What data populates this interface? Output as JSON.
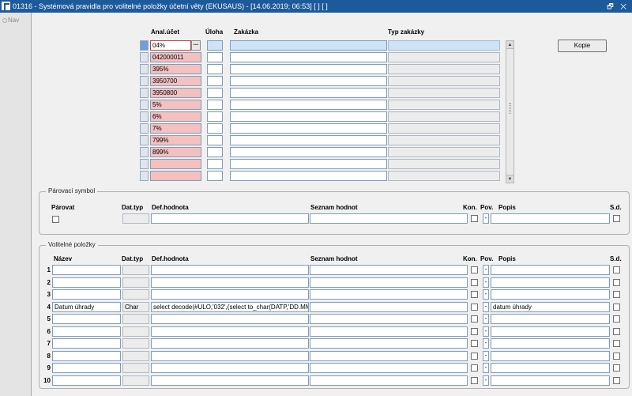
{
  "window": {
    "title": "01316 - Systémová pravidla pro volitelné položky účetní věty (EKUSAUS) - [14.06.2019; 06:53]  [ ]  [ ]",
    "controls": "🗗 ✕"
  },
  "nav": {
    "label": "Nav"
  },
  "top_table": {
    "headers": {
      "anal": "Anal.účet",
      "uloha": "Úloha",
      "zakazka": "Zakázka",
      "typ": "Typ zakázky"
    },
    "rows": [
      "04%",
      "042000011",
      "395%",
      "3950700",
      "3950800",
      "5%",
      "6%",
      "7%",
      "799%",
      "899%",
      "",
      ""
    ],
    "lov_button": "...",
    "copy_button": "Kopie"
  },
  "parovaci": {
    "legend": "Párovací symbol",
    "headers": {
      "parovat": "Párovat",
      "dattyp": "Dat.typ",
      "defhod": "Def.hodnota",
      "seznam": "Seznam hodnot",
      "kon": "Kon.",
      "pov": "Pov.",
      "popis": "Popis",
      "sd": "S.d."
    },
    "pov_value": "-"
  },
  "volitelne": {
    "legend": "Volitelné položky",
    "headers": {
      "nazev": "Název",
      "dattyp": "Dat.typ",
      "defhod": "Def.hodnota",
      "seznam": "Seznam hodnot",
      "kon": "Kon.",
      "pov": "Pov.",
      "popis": "Popis",
      "sd": "S.d."
    },
    "rows": [
      {
        "num": "1",
        "nazev": "",
        "dattyp": "",
        "defhod": "",
        "pov": "-",
        "popis": ""
      },
      {
        "num": "2",
        "nazev": "",
        "dattyp": "",
        "defhod": "",
        "pov": "-",
        "popis": ""
      },
      {
        "num": "3",
        "nazev": "",
        "dattyp": "",
        "defhod": "",
        "pov": "-",
        "popis": ""
      },
      {
        "num": "4",
        "nazev": "Datum úhrady",
        "dattyp": "Char",
        "defhod": "select decode(#ULO,'032',(select to_char(DATP,'DD.MM",
        "pov": "-",
        "popis": "datum úhrady"
      },
      {
        "num": "5",
        "nazev": "",
        "dattyp": "",
        "defhod": "",
        "pov": "-",
        "popis": ""
      },
      {
        "num": "6",
        "nazev": "",
        "dattyp": "",
        "defhod": "",
        "pov": "-",
        "popis": ""
      },
      {
        "num": "7",
        "nazev": "",
        "dattyp": "",
        "defhod": "",
        "pov": "-",
        "popis": ""
      },
      {
        "num": "8",
        "nazev": "",
        "dattyp": "",
        "defhod": "",
        "pov": "-",
        "popis": ""
      },
      {
        "num": "9",
        "nazev": "",
        "dattyp": "",
        "defhod": "",
        "pov": "-",
        "popis": ""
      },
      {
        "num": "10",
        "nazev": "",
        "dattyp": "",
        "defhod": "",
        "pov": "-",
        "popis": ""
      }
    ]
  }
}
